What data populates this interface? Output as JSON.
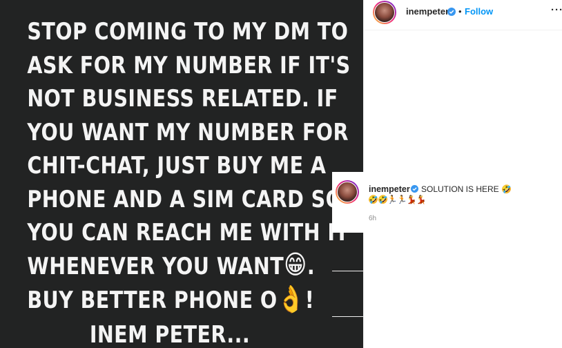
{
  "story": {
    "lines": [
      "STOP COMING TO MY DM TO",
      "ASK FOR MY NUMBER IF IT'S",
      "NOT BUSINESS RELATED. IF",
      "YOU WANT MY NUMBER FOR",
      "CHIT-CHAT, JUST BUY ME A",
      "PHONE AND A SIM CARD SO",
      "YOU CAN REACH ME WITH IT"
    ],
    "line8_text": "WHENEVER YOU WANT",
    "line8_end": ".",
    "line9_text": "BUY BETTER PHONE O",
    "line9_end": "!",
    "line10": "INEM PETER...",
    "emoji_grin": "😁",
    "emoji_ok": "👌"
  },
  "header": {
    "username": "inempeter",
    "separator": "•",
    "follow_label": "Follow",
    "more_label": "···"
  },
  "post": {
    "username": "inempeter",
    "caption": "SOLUTION IS HERE 🤣",
    "caption_line2": "🤣🤣🏃🏃💃💃",
    "time": "6h"
  },
  "colors": {
    "story_bg": "#222323",
    "accent": "#0095f6",
    "verified": "#3897f0"
  }
}
